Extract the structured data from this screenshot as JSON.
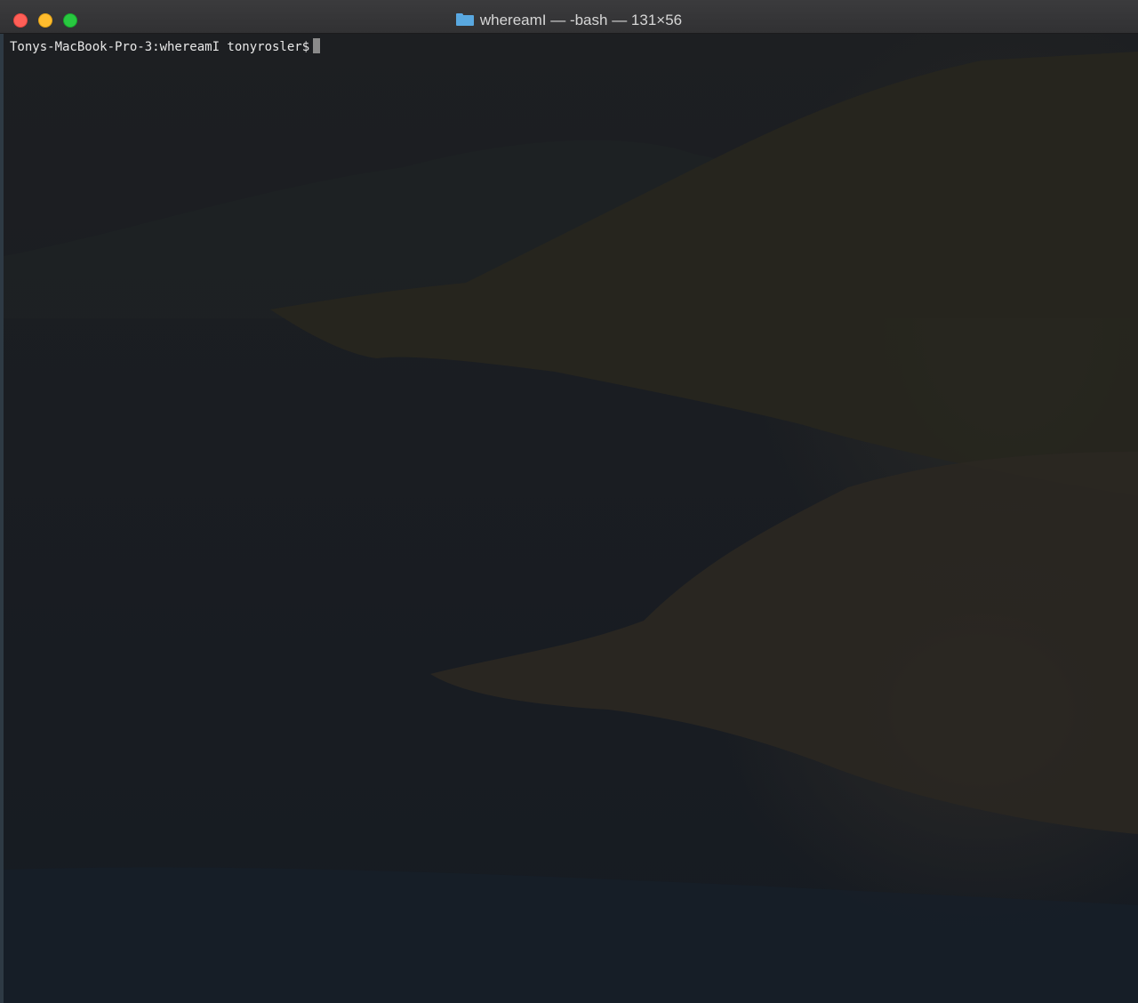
{
  "window": {
    "title": "whereamI — -bash — 131×56"
  },
  "terminal": {
    "prompt": "Tonys-MacBook-Pro-3:whereamI tonyrosler$",
    "input": ""
  },
  "colors": {
    "close": "#ff5f57",
    "minimize": "#febc2e",
    "zoom": "#28c840",
    "folder": "#59a8e0",
    "background": "#1c1e21"
  },
  "icons": {
    "folder": "folder-icon"
  }
}
